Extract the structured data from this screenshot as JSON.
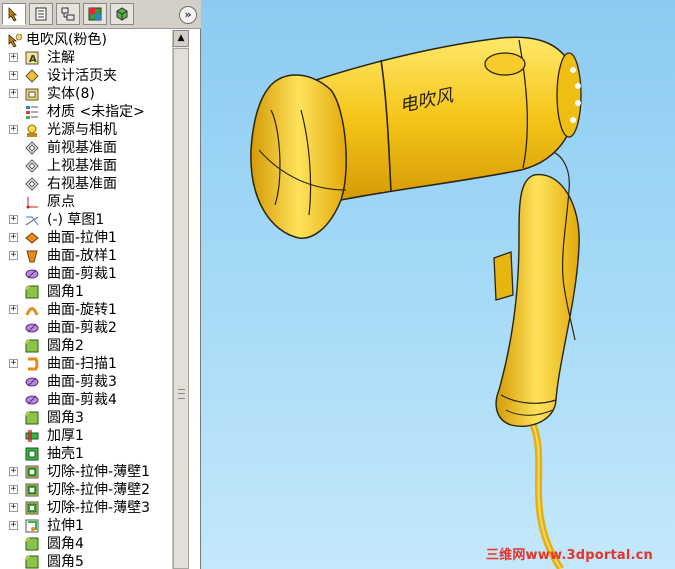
{
  "tabs": [
    {
      "name": "feature-manager-icon",
      "active": true
    },
    {
      "name": "property-manager-icon",
      "active": false
    },
    {
      "name": "configuration-manager-icon",
      "active": false
    },
    {
      "name": "appearance-icon",
      "active": false
    },
    {
      "name": "display-manager-icon",
      "active": false
    }
  ],
  "collapse_label": "»",
  "tree": {
    "root": "电吹风(粉色)",
    "items": [
      {
        "label": "注解",
        "icon": "annotation-icon",
        "expandable": true
      },
      {
        "label": "设计活页夹",
        "icon": "design-binder-icon",
        "expandable": true
      },
      {
        "label": "实体(8)",
        "icon": "solid-bodies-icon",
        "expandable": true
      },
      {
        "label": "材质 <未指定>",
        "icon": "material-icon",
        "expandable": false
      },
      {
        "label": "光源与相机",
        "icon": "lights-cameras-icon",
        "expandable": true
      },
      {
        "label": "前视基准面",
        "icon": "plane-icon",
        "expandable": false
      },
      {
        "label": "上视基准面",
        "icon": "plane-icon",
        "expandable": false
      },
      {
        "label": "右视基准面",
        "icon": "plane-icon",
        "expandable": false
      },
      {
        "label": "原点",
        "icon": "origin-icon",
        "expandable": false
      },
      {
        "label": "(-) 草图1",
        "icon": "sketch-icon",
        "expandable": true
      },
      {
        "label": "曲面-拉伸1",
        "icon": "surface-extrude-icon",
        "expandable": true
      },
      {
        "label": "曲面-放样1",
        "icon": "surface-loft-icon",
        "expandable": true
      },
      {
        "label": "曲面-剪裁1",
        "icon": "surface-trim-icon",
        "expandable": false
      },
      {
        "label": "圆角1",
        "icon": "fillet-icon",
        "expandable": false
      },
      {
        "label": "曲面-旋转1",
        "icon": "surface-revolve-icon",
        "expandable": true
      },
      {
        "label": "曲面-剪裁2",
        "icon": "surface-trim-icon",
        "expandable": false
      },
      {
        "label": "圆角2",
        "icon": "fillet-icon",
        "expandable": false
      },
      {
        "label": "曲面-扫描1",
        "icon": "surface-sweep-icon",
        "expandable": true
      },
      {
        "label": "曲面-剪裁3",
        "icon": "surface-trim-icon",
        "expandable": false
      },
      {
        "label": "曲面-剪裁4",
        "icon": "surface-trim-icon",
        "expandable": false
      },
      {
        "label": "圆角3",
        "icon": "fillet-icon",
        "expandable": false
      },
      {
        "label": "加厚1",
        "icon": "thicken-icon",
        "expandable": false
      },
      {
        "label": "抽壳1",
        "icon": "shell-icon",
        "expandable": false
      },
      {
        "label": "切除-拉伸-薄壁1",
        "icon": "cut-extrude-icon",
        "expandable": true
      },
      {
        "label": "切除-拉伸-薄壁2",
        "icon": "cut-extrude-icon",
        "expandable": true
      },
      {
        "label": "切除-拉伸-薄壁3",
        "icon": "cut-extrude-icon",
        "expandable": true
      },
      {
        "label": "拉伸1",
        "icon": "extrude-icon",
        "expandable": true
      },
      {
        "label": "圆角4",
        "icon": "fillet-icon",
        "expandable": false
      },
      {
        "label": "圆角5",
        "icon": "fillet-icon",
        "expandable": false
      }
    ]
  },
  "model": {
    "body_text": "电吹风",
    "body_color": "#f5c518",
    "edge_color": "#2a2410"
  },
  "watermark": "三维网www.3dportal.cn",
  "colors": {
    "viewport_top": "#8ccbf0",
    "viewport_bottom": "#c4e8fb",
    "panel_bg": "#ffffff"
  }
}
